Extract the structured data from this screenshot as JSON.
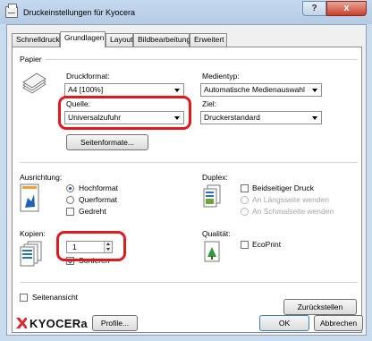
{
  "window": {
    "title": "Druckeinstellungen für Kyocera",
    "help_label": "?",
    "close_label": "x"
  },
  "tabs": [
    {
      "label": "Schnelldruck"
    },
    {
      "label": "Grundlagen"
    },
    {
      "label": "Layout"
    },
    {
      "label": "Bildbearbeitung"
    },
    {
      "label": "Erweitert"
    }
  ],
  "papier": {
    "section_label": "Papier",
    "format_label": "Druckformat:",
    "format_value": "A4 [100%]",
    "source_label": "Quelle:",
    "source_value": "Universalzufuhr",
    "media_label": "Medientyp:",
    "media_value": "Automatische Medienauswahl",
    "target_label": "Ziel:",
    "target_value": "Druckerstandard",
    "page_formats_button": "Seitenformate..."
  },
  "orientation": {
    "label": "Ausrichtung:",
    "options": [
      {
        "label": "Hochformat",
        "checked": true
      },
      {
        "label": "Querformat",
        "checked": false
      }
    ],
    "rotated_label": "Gedreht"
  },
  "duplex": {
    "label": "Duplex:",
    "duplex_print_label": "Beidseitiger Druck",
    "long_edge_label": "An Längsseite wenden",
    "short_edge_label": "An Schmalseite wenden"
  },
  "copies": {
    "label": "Kopien:",
    "value": "1",
    "collate_label": "Sortieren"
  },
  "quality": {
    "label": "Qualität:",
    "ecoprint_label": "EcoPrint"
  },
  "footer": {
    "page_view_label": "Seitenansicht",
    "reset_button": "Zurückstellen",
    "brand": "KYOCERa",
    "profile_button": "Profile...",
    "ok_button": "OK",
    "cancel_button": "Abbrechen"
  },
  "colors": {
    "highlight": "#e0191f",
    "brand_red": "#d9252b",
    "titlebar": "#c5d9ef"
  }
}
